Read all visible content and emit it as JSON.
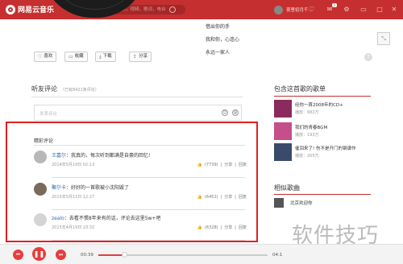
{
  "app": {
    "name": "网易云音乐"
  },
  "topbar": {
    "back": "‹",
    "forward": "›",
    "search_placeholder": "搜索音乐，视频，歌词，电台",
    "username": "夜里初月千...",
    "badge": "1"
  },
  "lyrics": [
    "借出你的手",
    "我和你，心连心",
    "永远一家人"
  ],
  "actions": {
    "like": "喜欢",
    "collect": "收藏",
    "download": "下载",
    "share": "分享"
  },
  "comments": {
    "title": "听友评论",
    "count_text": "（已有8421条评论）",
    "input_placeholder": "发表评论",
    "hot_label": "精彩评论",
    "items": [
      {
        "user": "王嘉尔",
        "text": "我真的，每次听到都满是自豪的回忆!",
        "time": "2014年5月19日 02:13",
        "likes": "(7739)",
        "share": "分享",
        "reply": "回复",
        "avatar_color": "#b8b8b8"
      },
      {
        "user": "聚尔卡",
        "text": "好好的一首歌被小沈阳毁了",
        "time": "2015年5月11日 12:27",
        "likes": "(6452)",
        "share": "分享",
        "reply": "回复",
        "avatar_color": "#7a6a5a"
      },
      {
        "user": "zealo",
        "text": "去看不惯8年来有的话，评论去这里5w+吧",
        "time": "2015年4月19日 23:32",
        "likes": "(6328)",
        "share": "分享",
        "reply": "回复",
        "avatar_color": "#d4d4d4"
      }
    ]
  },
  "right": {
    "playlist_title": "包含这首歌的歌单",
    "playlists": [
      {
        "name": "经你一首2008年的CD+",
        "plays": "播放：682万",
        "color": "#8b2a5c"
      },
      {
        "name": "我们的青春BGM",
        "plays": "播放：193万",
        "color": "#c44f8a"
      },
      {
        "name": "催泪来了! 伤不是开门的钢谱作",
        "plays": "播放：205万",
        "color": "#3a4a6a"
      }
    ],
    "similar_title": "相似歌曲",
    "similar": [
      {
        "name": "北京欢迎你"
      }
    ]
  },
  "player": {
    "current": "00:39",
    "total": "04:1",
    "progress": 0.15
  },
  "watermark": "软件技巧"
}
